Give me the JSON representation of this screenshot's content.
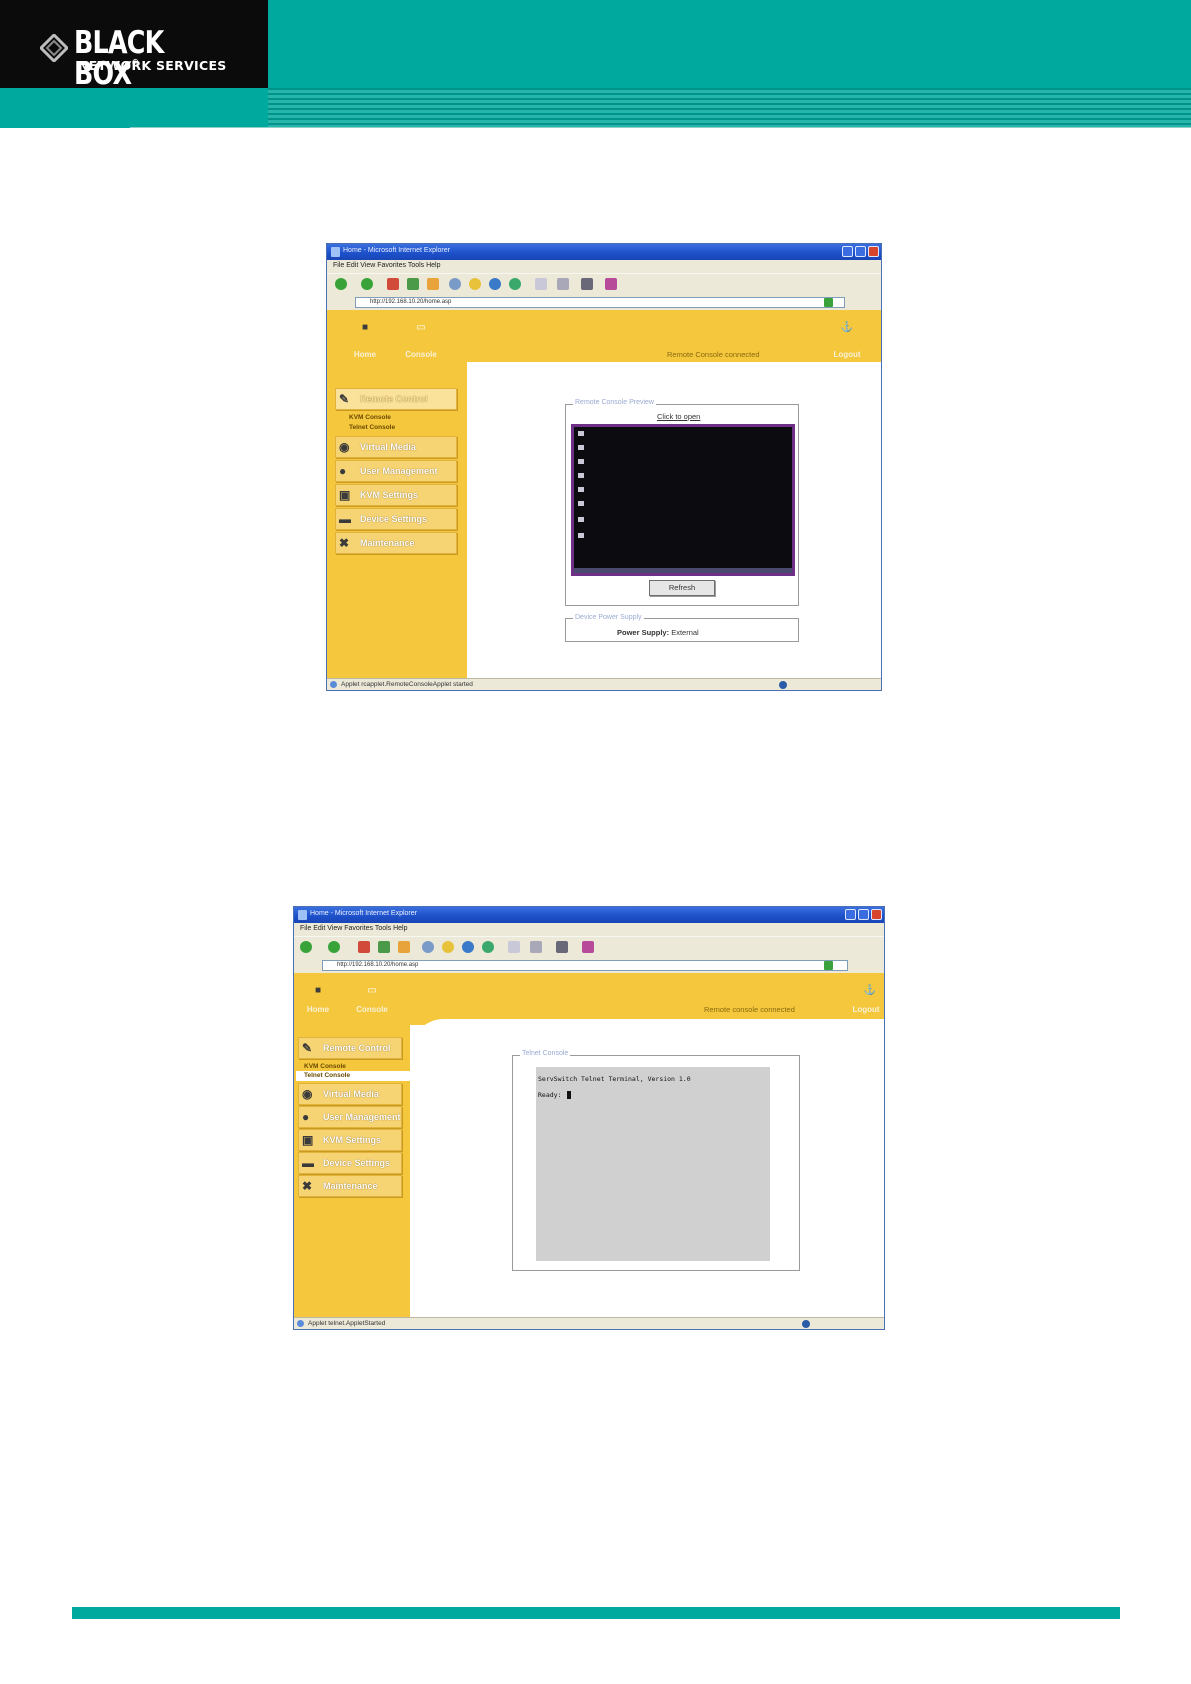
{
  "header": {
    "logo_main": "BLACK BOX",
    "logo_reg": "®",
    "logo_sub": "NETWORK SERVICES"
  },
  "colors": {
    "teal": "#00a99d",
    "app_yellow": "#f4c73c",
    "xp_blue": "#1c4fc9"
  },
  "figure1": {
    "window_title": "Home - Microsoft Internet Explorer",
    "menubar": "File  Edit  View  Favorites  Tools  Help",
    "address": "http://192.168.10.20/home.asp",
    "nav": {
      "home": "Home",
      "console": "Console",
      "logout": "Logout"
    },
    "connection_status": "Remote Console connected",
    "menu": {
      "remote_control": "Remote Control",
      "sub_kvm": "KVM Console",
      "sub_telnet": "Telnet Console",
      "virtual_media": "Virtual Media",
      "user_management": "User Management",
      "kvm_settings": "KVM Settings",
      "device_settings": "Device Settings",
      "maintenance": "Maintenance"
    },
    "preview_legend": "Remote Console Preview",
    "click_to_open": "Click to open",
    "refresh_label": "Refresh",
    "power_legend": "Device Power Supply",
    "power_label": "Power Supply:",
    "power_value": "External",
    "status_text": "Applet rcapplet.RemoteConsoleApplet started"
  },
  "figure2": {
    "window_title": "Home - Microsoft Internet Explorer",
    "menubar": "File  Edit  View  Favorites  Tools  Help",
    "address": "http://192.168.10.20/home.asp",
    "nav": {
      "home": "Home",
      "console": "Console",
      "logout": "Logout"
    },
    "connection_status": "Remote console connected",
    "menu": {
      "remote_control": "Remote Control",
      "sub_kvm": "KVM Console",
      "sub_telnet": "Telnet Console",
      "virtual_media": "Virtual Media",
      "user_management": "User Management",
      "kvm_settings": "KVM Settings",
      "device_settings": "Device Settings",
      "maintenance": "Maintenance"
    },
    "telnet_legend": "Telnet Console",
    "terminal_line1": "ServSwitch Telnet Terminal, Version 1.0",
    "terminal_line2": "Ready: ",
    "status_text": "Applet telnet.AppletStarted"
  }
}
